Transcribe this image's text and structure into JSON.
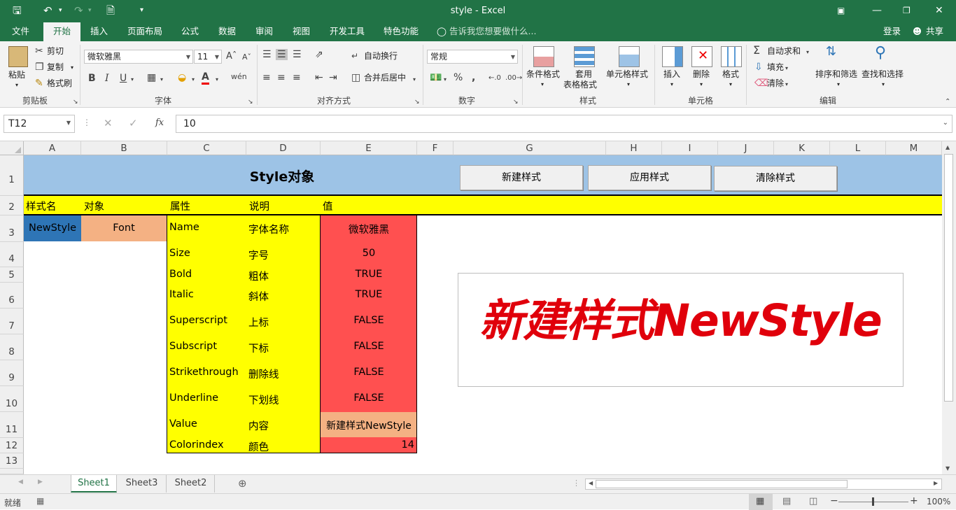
{
  "window": {
    "title": "style - Excel"
  },
  "tabs": {
    "file": "文件",
    "home": "开始",
    "insert": "插入",
    "layout": "页面布局",
    "formulas": "公式",
    "data": "数据",
    "review": "审阅",
    "view": "视图",
    "developer": "开发工具",
    "special": "特色功能",
    "tell_me": "告诉我您想要做什么...",
    "login": "登录",
    "share": "共享"
  },
  "ribbon": {
    "clipboard": {
      "paste": "粘贴",
      "cut": "剪切",
      "copy": "复制",
      "format_painter": "格式刷",
      "group": "剪贴板"
    },
    "font": {
      "name": "微软雅黑",
      "size": "11",
      "bold": "B",
      "italic": "I",
      "underline": "U",
      "group": "字体"
    },
    "alignment": {
      "wrap": "自动换行",
      "merge": "合并后居中",
      "group": "对齐方式"
    },
    "number": {
      "format": "常规",
      "group": "数字"
    },
    "styles": {
      "conditional": "条件格式",
      "table1": "套用",
      "table2": "表格格式",
      "cell_styles": "单元格样式",
      "group": "样式"
    },
    "cells": {
      "insert": "插入",
      "delete": "删除",
      "format": "格式",
      "group": "单元格"
    },
    "editing": {
      "autosum": "自动求和",
      "fill": "填充",
      "clear": "清除",
      "sort": "排序和筛选",
      "find": "查找和选择",
      "group": "编辑"
    }
  },
  "formula_bar": {
    "name_box": "T12",
    "fx": "fx",
    "value": "10"
  },
  "columns": [
    "A",
    "B",
    "C",
    "D",
    "E",
    "F",
    "G",
    "H",
    "I",
    "J",
    "K",
    "L",
    "M"
  ],
  "rows": [
    "1",
    "2",
    "3",
    "4",
    "5",
    "6",
    "7",
    "8",
    "9",
    "10",
    "11",
    "12",
    "13"
  ],
  "sheet": {
    "title": "Style对象",
    "buttons": {
      "new": "新建样式",
      "apply": "应用样式",
      "clear": "清除样式"
    },
    "headers": {
      "a": "样式名",
      "b": "对象",
      "c": "属性",
      "d": "说明",
      "e": "值"
    },
    "style_name": "NewStyle",
    "object": "Font",
    "properties": [
      {
        "name": "Name",
        "desc": "字体名称",
        "value": "微软雅黑"
      },
      {
        "name": "Size",
        "desc": "字号",
        "value": "50"
      },
      {
        "name": "Bold",
        "desc": "粗体",
        "value": "TRUE"
      },
      {
        "name": "Italic",
        "desc": "斜体",
        "value": "TRUE"
      },
      {
        "name": "Superscript",
        "desc": "上标",
        "value": "FALSE"
      },
      {
        "name": "Subscript",
        "desc": "下标",
        "value": "FALSE"
      },
      {
        "name": "Strikethrough",
        "desc": "删除线",
        "value": "FALSE"
      },
      {
        "name": "Underline",
        "desc": "下划线",
        "value": "FALSE"
      },
      {
        "name": "Value",
        "desc": "内容",
        "value": "新建样式NewStyle"
      },
      {
        "name": "Colorindex",
        "desc": "颜色",
        "value": "14"
      }
    ],
    "preview_text": "新建样式NewStyle"
  },
  "sheet_tabs": [
    "Sheet1",
    "Sheet3",
    "Sheet2"
  ],
  "status": {
    "ready": "就绪",
    "zoom": "100%"
  },
  "colors": {
    "accent": "#217346",
    "header_blue": "#9dc3e6",
    "yellow": "#ffff00",
    "red": "#ff5050",
    "salmon": "#f4b183",
    "blue_cell": "#2e75b6",
    "preview_red": "#e0000b"
  }
}
